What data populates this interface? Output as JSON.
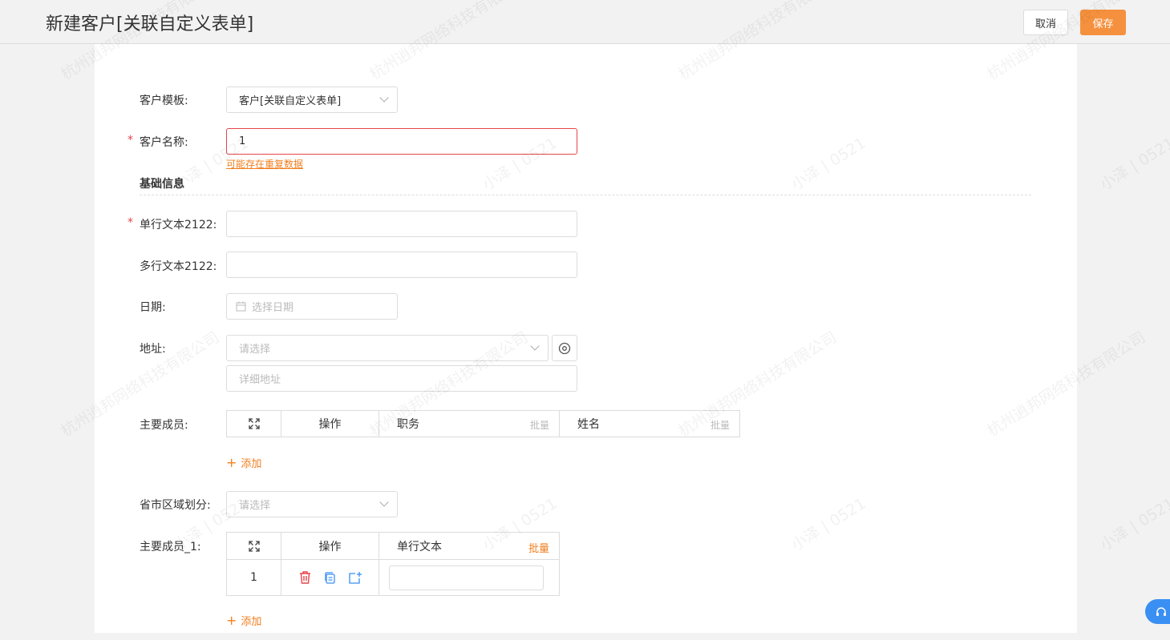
{
  "header": {
    "title": "新建客户[关联自定义表单]",
    "cancel_label": "取消",
    "save_label": "保存"
  },
  "form": {
    "template": {
      "label": "客户模板:",
      "value": "客户[关联自定义表单]"
    },
    "customer_name": {
      "label": "客户名称:",
      "value": "1",
      "hint": "可能存在重复数据"
    },
    "section_title": "基础信息",
    "single_text": {
      "label": "单行文本2122:",
      "value": ""
    },
    "multi_text": {
      "label": "多行文本2122:",
      "value": ""
    },
    "date": {
      "label": "日期:",
      "placeholder": "选择日期"
    },
    "address": {
      "label": "地址:",
      "placeholder": "请选择",
      "detail_placeholder": "详细地址"
    },
    "members": {
      "label": "主要成员:",
      "columns": [
        "操作",
        "职务",
        "姓名"
      ],
      "batch_label": "批量",
      "add_label": "添加"
    },
    "region": {
      "label": "省市区域划分:",
      "placeholder": "请选择"
    },
    "members_1": {
      "label": "主要成员_1:",
      "columns": [
        "操作",
        "单行文本"
      ],
      "batch_label": "批量",
      "rows": [
        {
          "index": "1",
          "text": ""
        }
      ],
      "add_label": "添加"
    }
  },
  "watermarks": [
    "杭州逍邦网络科技有限公司",
    "小泽 | 0521"
  ],
  "colors": {
    "accent": "#f5913e",
    "error": "#e5454a",
    "link": "#f07f1f",
    "help": "#3a8ff2"
  }
}
